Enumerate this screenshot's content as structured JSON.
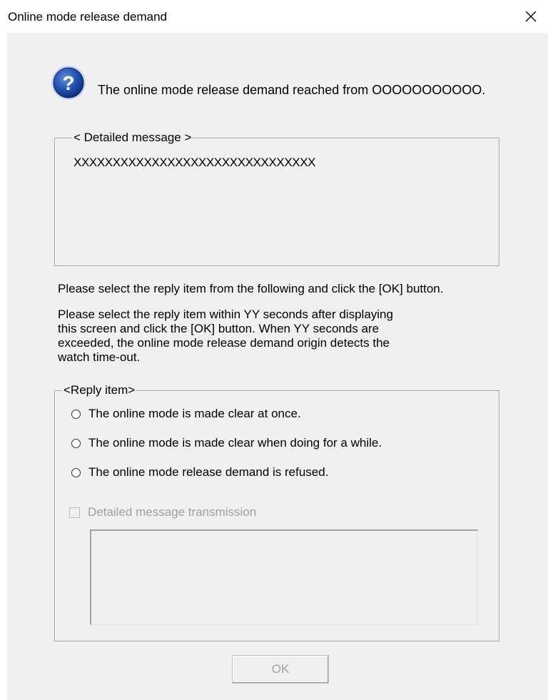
{
  "window": {
    "title": "Online mode release demand"
  },
  "icons": {
    "question": "question-icon",
    "close": "close-icon"
  },
  "main_message": "The online mode release demand reached from OOOOOOOOOOO.",
  "detail_group": {
    "legend": "< Detailed message >",
    "text": "XXXXXXXXXXXXXXXXXXXXXXXXXXXXXXX"
  },
  "instructions": {
    "line1": "Please select the reply item from the following and click the [OK] button.",
    "line2": [
      "Please select the reply item within  YY  seconds after displaying",
      "this screen and click the [OK] button. When  YY  seconds are",
      "exceeded, the online mode release demand origin detects the",
      "watch time-out."
    ]
  },
  "reply_group": {
    "legend": "<Reply item>",
    "options": [
      "The online mode is made clear at once.",
      "The online mode is made clear when doing for a while.",
      "The online mode release demand is refused."
    ],
    "checkbox_label": "Detailed message transmission",
    "checkbox_checked": false,
    "checkbox_enabled": false
  },
  "buttons": {
    "ok": "OK"
  },
  "colors": {
    "dialog_bg": "#f0f0f0",
    "icon_blue": "#1f4ea8",
    "disabled_text": "#a0a0a0"
  }
}
